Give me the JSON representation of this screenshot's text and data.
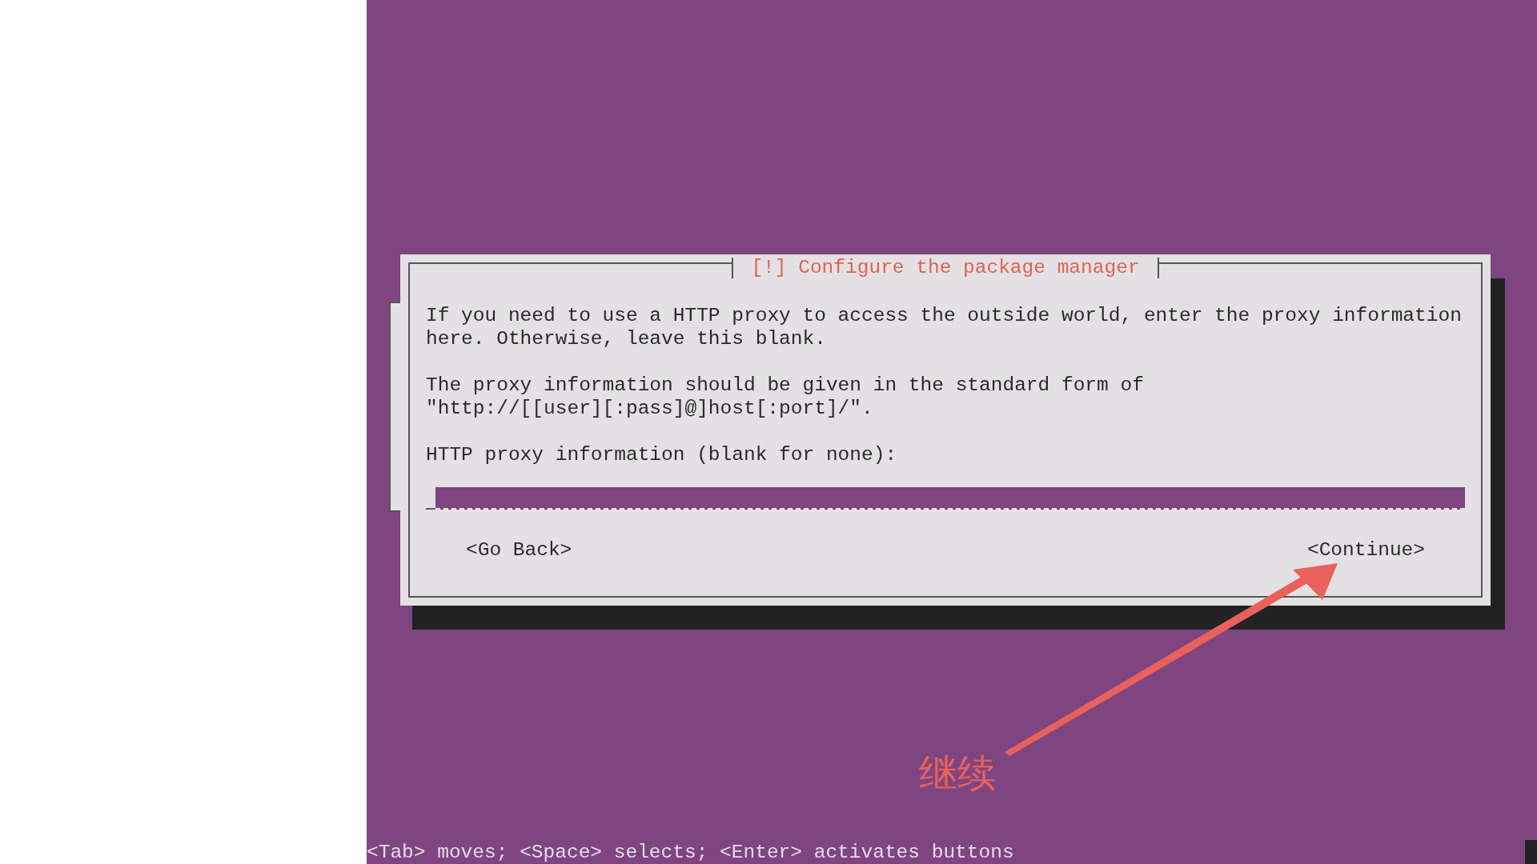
{
  "dialog": {
    "title": "[!] Configure the package manager",
    "paragraphs": [
      "If you need to use a HTTP proxy to access the outside world, enter the proxy information here. Otherwise, leave this blank.",
      "The proxy information should be given in the standard form of \"http://[[user][:pass]@]host[:port]/\"."
    ],
    "prompt": "HTTP proxy information (blank for none):",
    "buttons": [
      {
        "label": "<Go Back>"
      },
      {
        "label": "<Continue>"
      }
    ]
  },
  "annotation": {
    "text": "继续"
  },
  "status_bar": "<Tab> moves; <Space> selects; <Enter> activates buttons"
}
